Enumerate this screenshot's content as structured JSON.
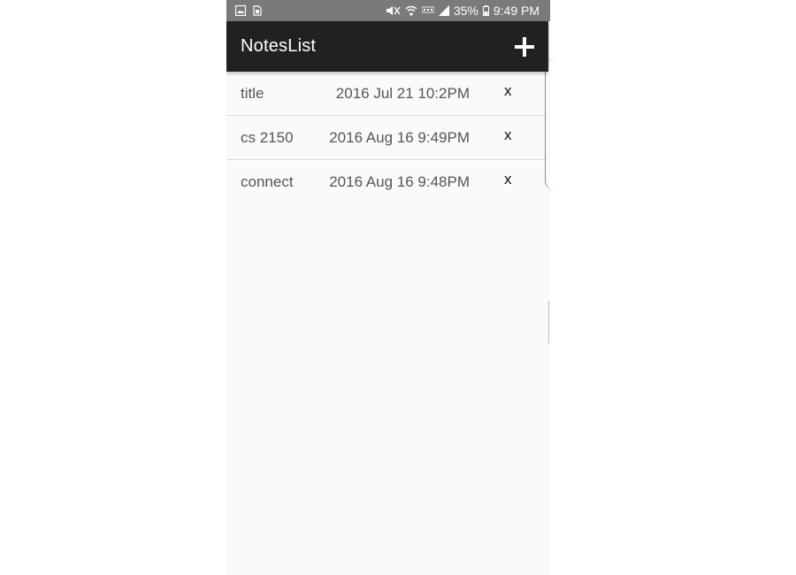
{
  "status_bar": {
    "battery_percent": "35%",
    "time": "9:49 PM",
    "icons": [
      "image-icon",
      "sim-icon",
      "mute-icon",
      "wifi-icon",
      "lte-icon",
      "signal-icon",
      "battery-icon"
    ]
  },
  "app_bar": {
    "title": "NotesList",
    "add_icon": "plus-icon"
  },
  "notes": [
    {
      "title": "title",
      "date": "2016 Jul 21 10:2PM",
      "delete_label": "x"
    },
    {
      "title": "cs 2150",
      "date": "2016 Aug 16 9:49PM",
      "delete_label": "x"
    },
    {
      "title": "connect",
      "date": "2016 Aug 16 9:48PM",
      "delete_label": "x"
    }
  ],
  "colors": {
    "status_bar": "#7a7a7a",
    "app_bar": "#212121",
    "background": "#fafafa"
  }
}
